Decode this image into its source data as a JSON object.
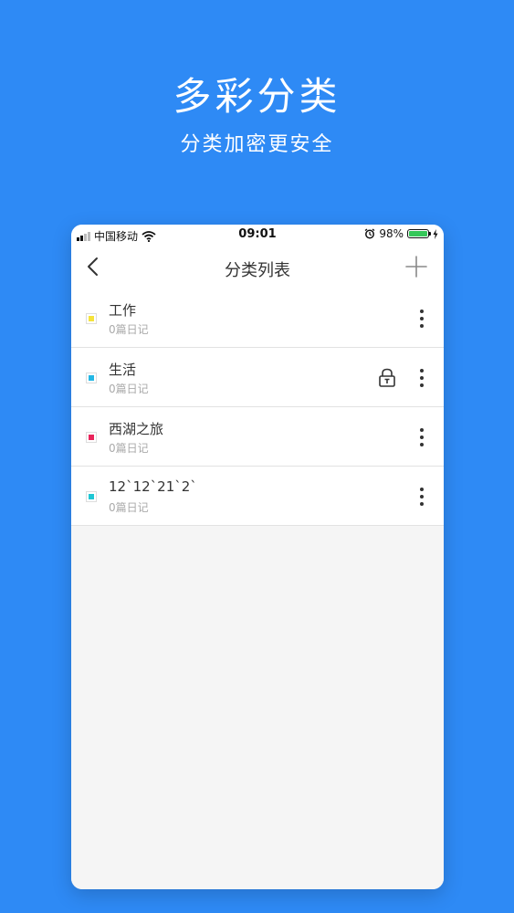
{
  "promo": {
    "title": "多彩分类",
    "subtitle": "分类加密更安全"
  },
  "status_bar": {
    "carrier": "中国移动",
    "time": "09:01",
    "battery": "98%",
    "battery_level": 0.98
  },
  "nav": {
    "title": "分类列表",
    "back_icon": "chevron-left-icon",
    "add_icon": "plus-icon"
  },
  "categories": [
    {
      "name": "工作",
      "count": "0篇日记",
      "color": "#f5e33b",
      "locked": false
    },
    {
      "name": "生活",
      "count": "0篇日记",
      "color": "#23b7e5",
      "locked": true
    },
    {
      "name": "西湖之旅",
      "count": "0篇日记",
      "color": "#e9245b",
      "locked": false
    },
    {
      "name": "12`12`21`2`",
      "count": "0篇日记",
      "color": "#1fc7d4",
      "locked": false
    }
  ],
  "colors": {
    "background": "#2e8af5",
    "battery": "#35c759"
  }
}
